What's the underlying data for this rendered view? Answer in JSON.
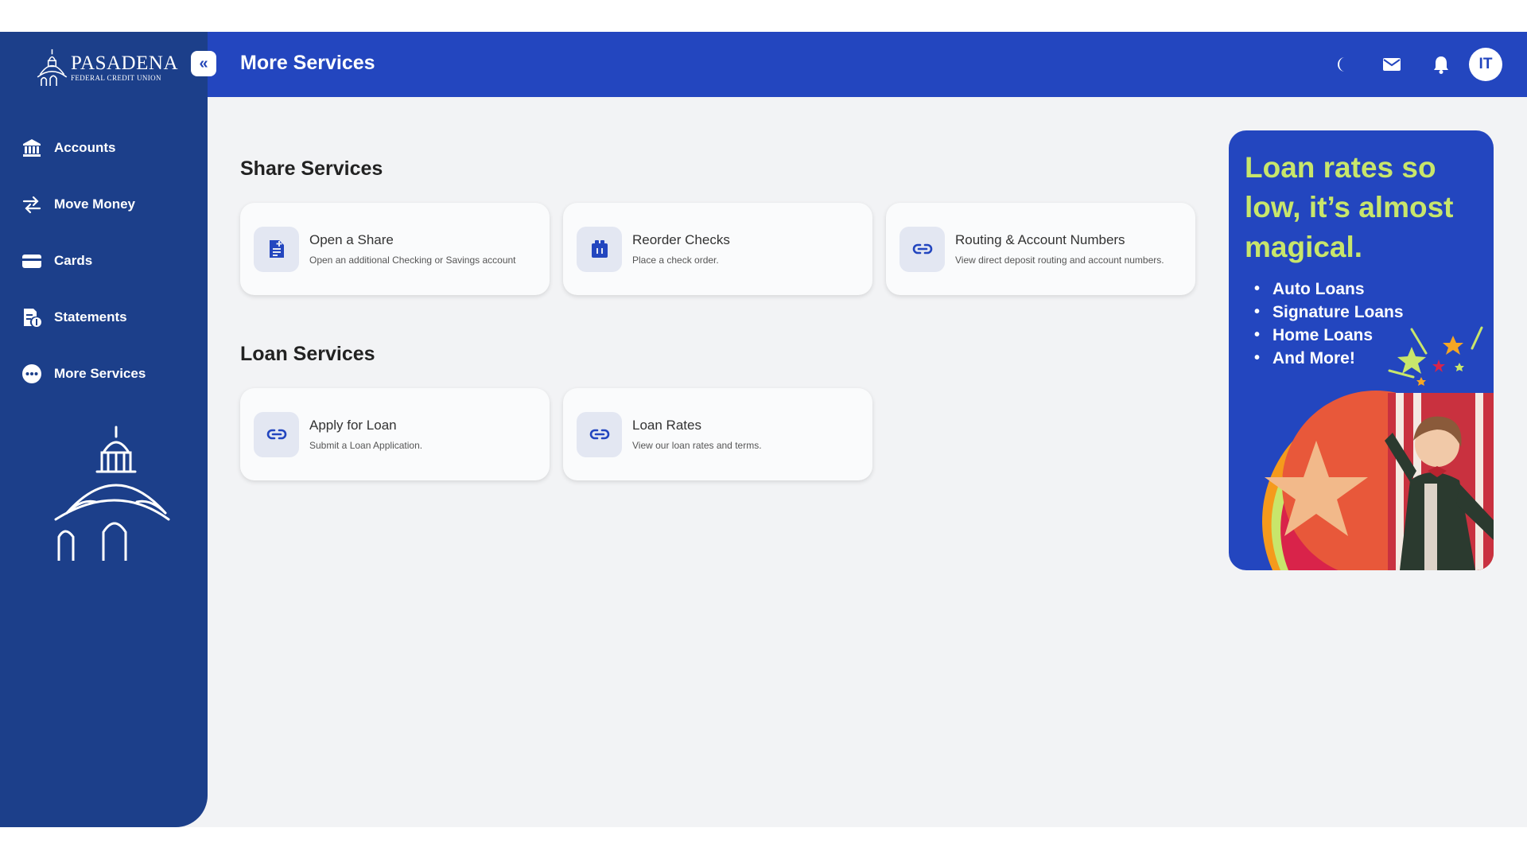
{
  "brand": {
    "name": "PASADENA",
    "subtitle": "FEDERAL CREDIT UNION"
  },
  "sidebar": {
    "collapse_icon": "double-chevron-left-icon",
    "items": [
      {
        "label": "Accounts",
        "icon": "bank-icon"
      },
      {
        "label": "Move Money",
        "icon": "transfer-icon"
      },
      {
        "label": "Cards",
        "icon": "card-icon"
      },
      {
        "label": "Statements",
        "icon": "statement-icon"
      },
      {
        "label": "More Services",
        "icon": "more-icon"
      }
    ]
  },
  "header": {
    "title": "More Services",
    "icons": [
      "moon-icon",
      "mail-icon",
      "bell-icon"
    ],
    "avatar_initials": "IT"
  },
  "sections": [
    {
      "title": "Share Services",
      "cards": [
        {
          "title": "Open a Share",
          "description": "Open an additional Checking or Savings account",
          "icon": "add-document-icon"
        },
        {
          "title": "Reorder Checks",
          "description": "Place a check order.",
          "icon": "checkbook-icon"
        },
        {
          "title": "Routing & Account Numbers",
          "description": "View direct deposit routing and account numbers.",
          "icon": "link-icon"
        }
      ]
    },
    {
      "title": "Loan Services",
      "cards": [
        {
          "title": "Apply for Loan",
          "description": "Submit a Loan Application.",
          "icon": "link-icon"
        },
        {
          "title": "Loan Rates",
          "description": "View our loan rates and terms.",
          "icon": "link-icon"
        }
      ]
    }
  ],
  "ad": {
    "headline": "Loan rates so low, it’s almost magical.",
    "items": [
      "Auto Loans",
      "Signature Loans",
      "Home Loans",
      "And More!"
    ]
  },
  "colors": {
    "sidebar": "#1c3f8a",
    "header": "#2346bf",
    "background": "#f2f3f5",
    "ad_headline": "#c8e66b",
    "icon_tile": "#e3e7f2"
  }
}
